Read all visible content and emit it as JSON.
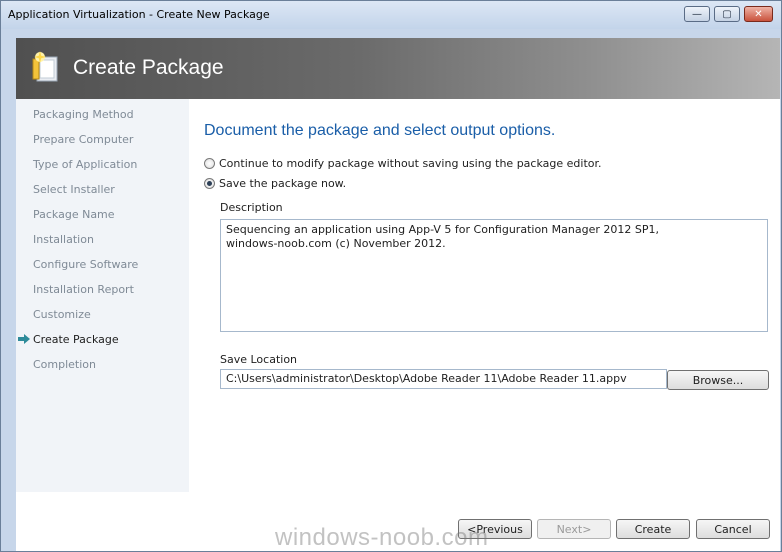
{
  "window": {
    "title": "Application Virtualization - Create New Package",
    "minimize_glyph": "—",
    "maximize_glyph": "▢",
    "close_glyph": "✕"
  },
  "banner": {
    "title": "Create Package",
    "icon": "package-icon"
  },
  "nav": {
    "items": [
      {
        "label": "Packaging Method"
      },
      {
        "label": "Prepare Computer"
      },
      {
        "label": "Type of Application"
      },
      {
        "label": "Select Installer"
      },
      {
        "label": "Package Name"
      },
      {
        "label": "Installation"
      },
      {
        "label": "Configure Software"
      },
      {
        "label": "Installation Report"
      },
      {
        "label": "Customize"
      },
      {
        "label": "Create Package",
        "active": true
      },
      {
        "label": "Completion"
      }
    ],
    "active_icon": "arrow-right-icon"
  },
  "main": {
    "heading": "Document the package and select output options.",
    "options": [
      {
        "label": "Continue to modify package without saving using the package editor.",
        "checked": false
      },
      {
        "label": "Save the package now.",
        "checked": true
      }
    ],
    "description_label": "Description",
    "description_value": "Sequencing an application using App-V 5 for Configuration Manager 2012 SP1,\nwindows-noob.com (c) November 2012.",
    "save_location_label": "Save Location",
    "save_location_value": "C:\\Users\\administrator\\Desktop\\Adobe Reader 11\\Adobe Reader 11.appv",
    "browse_label": "Browse..."
  },
  "footer": {
    "previous_label": "<Previous",
    "next_label": "Next>",
    "create_label": "Create",
    "cancel_label": "Cancel"
  },
  "watermark": "windows-noob.com",
  "colors": {
    "heading": "#1a5ea8",
    "nav_inactive": "#7f8a96",
    "active_arrow": "#2e8b9a"
  }
}
